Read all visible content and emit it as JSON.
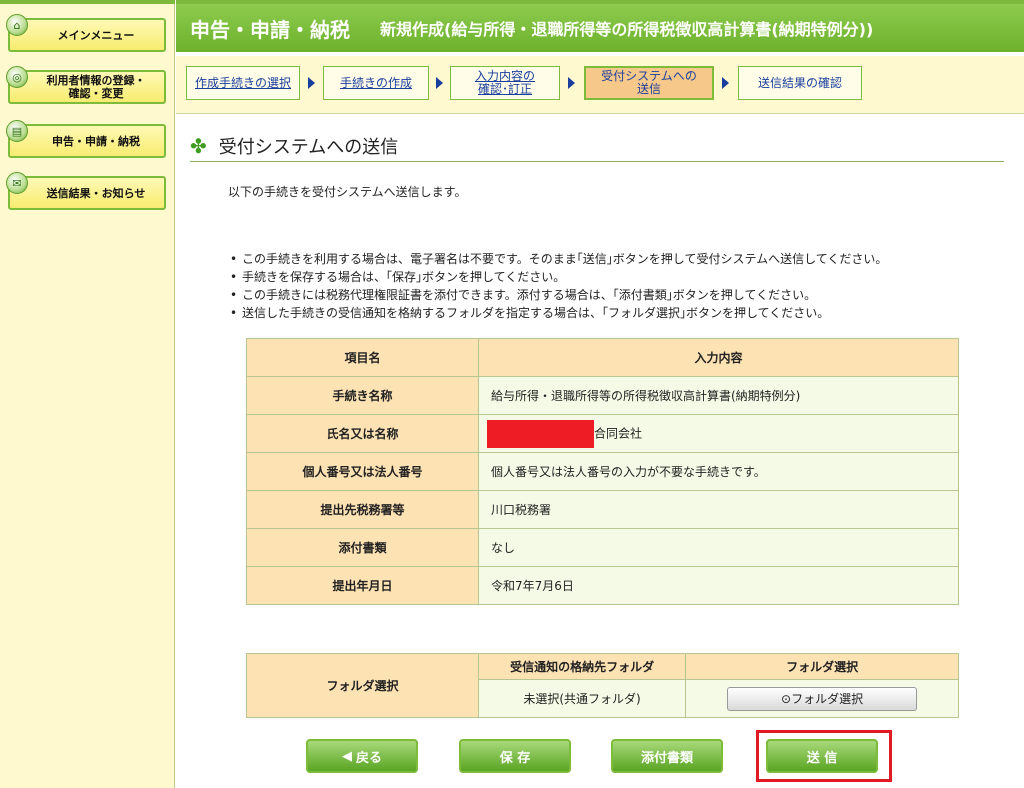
{
  "nav": {
    "items": [
      {
        "label": "メインメニュー",
        "icon": "home-icon"
      },
      {
        "label": "利用者情報の登録・\n確認・変更",
        "icon": "user-settings-icon"
      },
      {
        "label": "申告・申請・納税",
        "icon": "document-icon"
      },
      {
        "label": "送信結果・お知らせ",
        "icon": "mail-icon"
      }
    ]
  },
  "header": {
    "section": "申告・申請・納税",
    "title": "新規作成(給与所得・退職所得等の所得税徴収高計算書(納期特例分))"
  },
  "steps": [
    {
      "label": "作成手続きの選択"
    },
    {
      "label": "手続きの作成"
    },
    {
      "label": "入力内容の\n確認･訂正"
    },
    {
      "label": "受付システムへの\n送信"
    },
    {
      "label": "送信結果の確認"
    }
  ],
  "page": {
    "heading": "受付システムへの送信",
    "lead": "以下の手続きを受付システムへ送信します。",
    "notes": [
      "この手続きを利用する場合は、電子署名は不要です。そのまま｢送信｣ボタンを押して受付システムへ送信してください。",
      "手続きを保存する場合は、｢保存｣ボタンを押してください。",
      "この手続きには税務代理権限証書を添付できます。添付する場合は、｢添付書類｣ボタンを押してください。",
      "送信した手続きの受信通知を格納するフォルダを指定する場合は、｢フォルダ選択｣ボタンを押してください。"
    ]
  },
  "info_table": {
    "headers": [
      "項目名",
      "入力内容"
    ],
    "rows": [
      {
        "label": "手続き名称",
        "value": "給与所得・退職所得等の所得税徴収高計算書(納期特例分)"
      },
      {
        "label": "氏名又は名称",
        "value": "合同会社"
      },
      {
        "label": "個人番号又は法人番号",
        "value": "個人番号又は法人番号の入力が不要な手続きです。"
      },
      {
        "label": "提出先税務署等",
        "value": "川口税務署"
      },
      {
        "label": "添付書類",
        "value": "なし"
      },
      {
        "label": "提出年月日",
        "value": "令和7年7月6日"
      }
    ]
  },
  "folder_table": {
    "label": "フォルダ選択",
    "col1": "受信通知の格納先フォルダ",
    "col2": "フォルダ選択",
    "current": "未選択(共通フォルダ)",
    "button": "フォルダ選択"
  },
  "buttons": {
    "back": "戻る",
    "save": "保 存",
    "attach": "添付書類",
    "send": "送 信"
  },
  "colors": {
    "header_green": "#6cb22c",
    "highlight_red": "#e01b23",
    "label_bg": "#fde2b4",
    "value_bg": "#f4fae5"
  }
}
